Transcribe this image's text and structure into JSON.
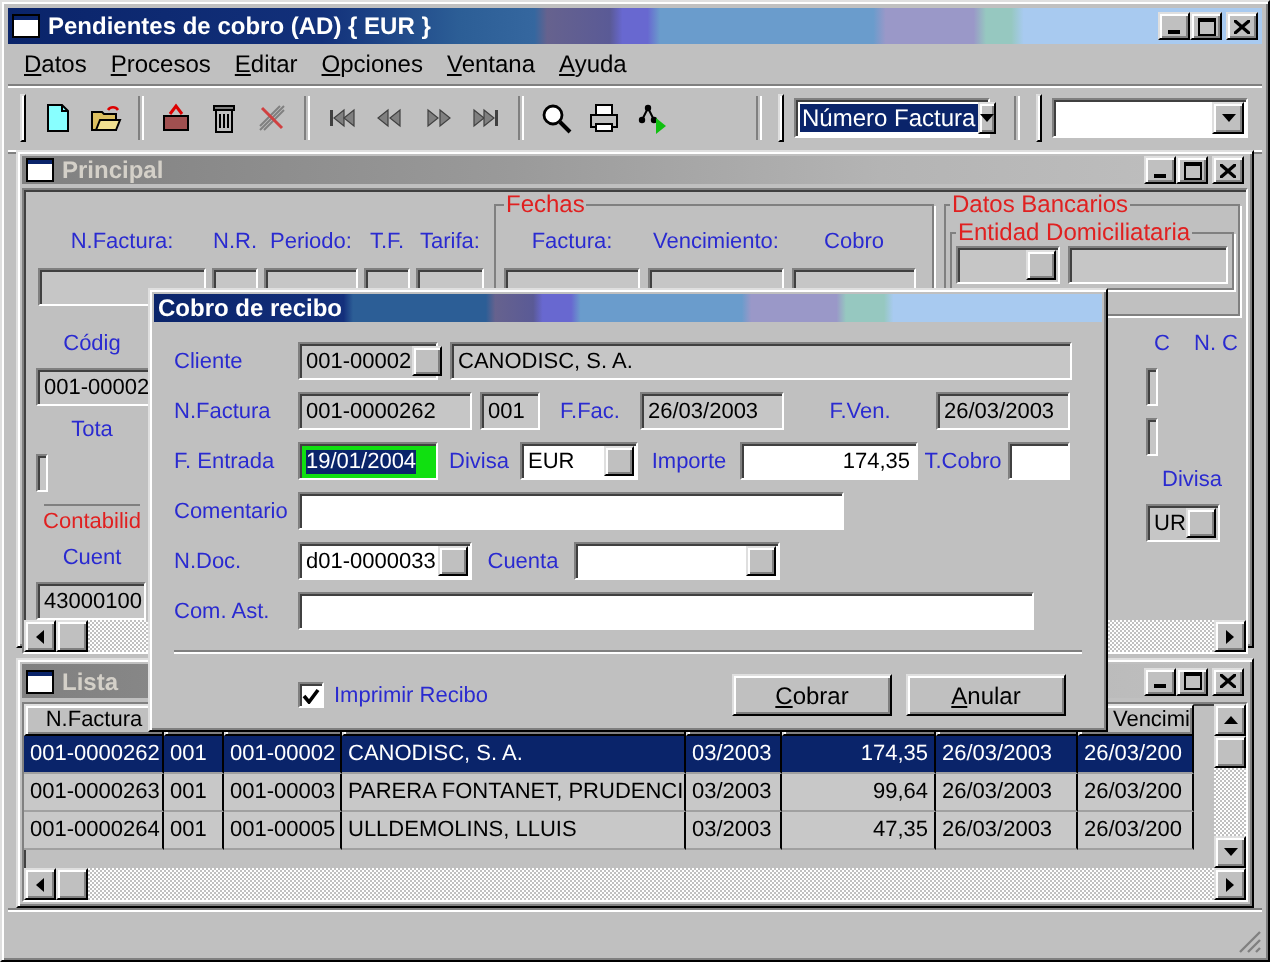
{
  "window": {
    "title": "Pendientes de cobro (AD) { EUR }"
  },
  "menu": [
    {
      "label": "Datos"
    },
    {
      "label": "Procesos"
    },
    {
      "label": "Editar"
    },
    {
      "label": "Opciones"
    },
    {
      "label": "Ventana"
    },
    {
      "label": "Ayuda"
    }
  ],
  "toolbar": {
    "sort_combo": {
      "value": "Número Factura"
    }
  },
  "principal": {
    "title": "Principal",
    "columns": [
      "N.Factura:",
      "N.R.",
      "Periodo:",
      "T.F.",
      "Tarifa:"
    ],
    "fechas": {
      "title": "Fechas",
      "columns": [
        "Factura:",
        "Vencimiento:",
        "Cobro"
      ]
    },
    "datos_bancarios": {
      "title": "Datos Bancarios",
      "entidad_title": "Entidad Domiciliataria"
    },
    "left": [
      {
        "kind": "label",
        "text": "Códig"
      },
      {
        "kind": "field",
        "value": "001-00002"
      },
      {
        "kind": "label",
        "text": "Tota"
      },
      {
        "kind": "field"
      },
      {
        "kind": "group",
        "text": "Contabilid"
      },
      {
        "kind": "label",
        "text": "Cuent"
      },
      {
        "kind": "field",
        "value": "43000100"
      }
    ],
    "right": [
      {
        "kind": "labels",
        "texts": [
          "C",
          "N. C"
        ]
      },
      {
        "kind": "field"
      },
      {
        "kind": "field"
      },
      {
        "kind": "label",
        "text": "Divisa"
      },
      {
        "kind": "lookup",
        "value": "UR"
      }
    ]
  },
  "lista": {
    "title": "Lista",
    "header": {
      "column_1": "N.Factura",
      "column_8": "Vencimi"
    },
    "rows": [
      {
        "selected": true,
        "cells": [
          "001-0000262",
          "001",
          "001-00002",
          "CANODISC, S. A.",
          "03/2003",
          "174,35",
          "26/03/2003",
          "26/03/200"
        ]
      },
      {
        "selected": false,
        "cells": [
          "001-0000263",
          "001",
          "001-00003",
          "PARERA FONTANET, PRUDENCI",
          "03/2003",
          "99,64",
          "26/03/2003",
          "26/03/200"
        ]
      },
      {
        "selected": false,
        "cells": [
          "001-0000264",
          "001",
          "001-00005",
          "ULLDEMOLINS, LLUIS",
          "03/2003",
          "47,35",
          "26/03/2003",
          "26/03/200"
        ]
      }
    ]
  },
  "dialog": {
    "title": "Cobro de recibo",
    "rows": [
      [
        {
          "kind": "label",
          "text": "Cliente"
        },
        {
          "kind": "lookup",
          "value": "001-00002",
          "readonly": true,
          "focused": false
        },
        {
          "kind": "field",
          "value": "CANODISC, S. A.",
          "readonly": true,
          "focused": false
        }
      ],
      [
        {
          "kind": "label",
          "text": "N.Factura"
        },
        {
          "kind": "field",
          "value": "001-0000262",
          "readonly": true,
          "focused": false
        },
        {
          "kind": "field",
          "value": "001",
          "readonly": true,
          "focused": false
        },
        {
          "kind": "label",
          "text": "F.Fac."
        },
        {
          "kind": "field",
          "value": "26/03/2003",
          "readonly": true,
          "focused": false
        },
        {
          "kind": "label",
          "text": "F.Ven."
        },
        {
          "kind": "field",
          "value": "26/03/2003",
          "readonly": true,
          "focused": false
        }
      ],
      [
        {
          "kind": "label",
          "text": "F. Entrada"
        },
        {
          "kind": "field",
          "value": "19/01/2004",
          "readonly": false,
          "focused": true
        },
        {
          "kind": "label",
          "text": "Divisa"
        },
        {
          "kind": "lookup",
          "value": "EUR",
          "readonly": false,
          "focused": false
        },
        {
          "kind": "label",
          "text": "Importe"
        },
        {
          "kind": "amount",
          "value": "174,35",
          "readonly": false,
          "focused": false
        },
        {
          "kind": "label",
          "text": "T.Cobro"
        },
        {
          "kind": "field",
          "readonly": false,
          "focused": false
        }
      ],
      [
        {
          "kind": "label",
          "text": "Comentario"
        },
        {
          "kind": "field",
          "readonly": false,
          "focused": false
        }
      ],
      [
        {
          "kind": "label",
          "text": "N.Doc."
        },
        {
          "kind": "lookup",
          "value": "d01-0000033",
          "readonly": false,
          "focused": false
        },
        {
          "kind": "label",
          "text": "Cuenta"
        },
        {
          "kind": "lookup",
          "readonly": false,
          "focused": false
        }
      ],
      [
        {
          "kind": "label",
          "text": "Com. Ast."
        },
        {
          "kind": "field",
          "readonly": false,
          "focused": false
        }
      ]
    ],
    "checkbox": {
      "label": "Imprimir Recibo",
      "checked": true
    },
    "buttons": [
      "Cobrar",
      "Anular"
    ]
  }
}
